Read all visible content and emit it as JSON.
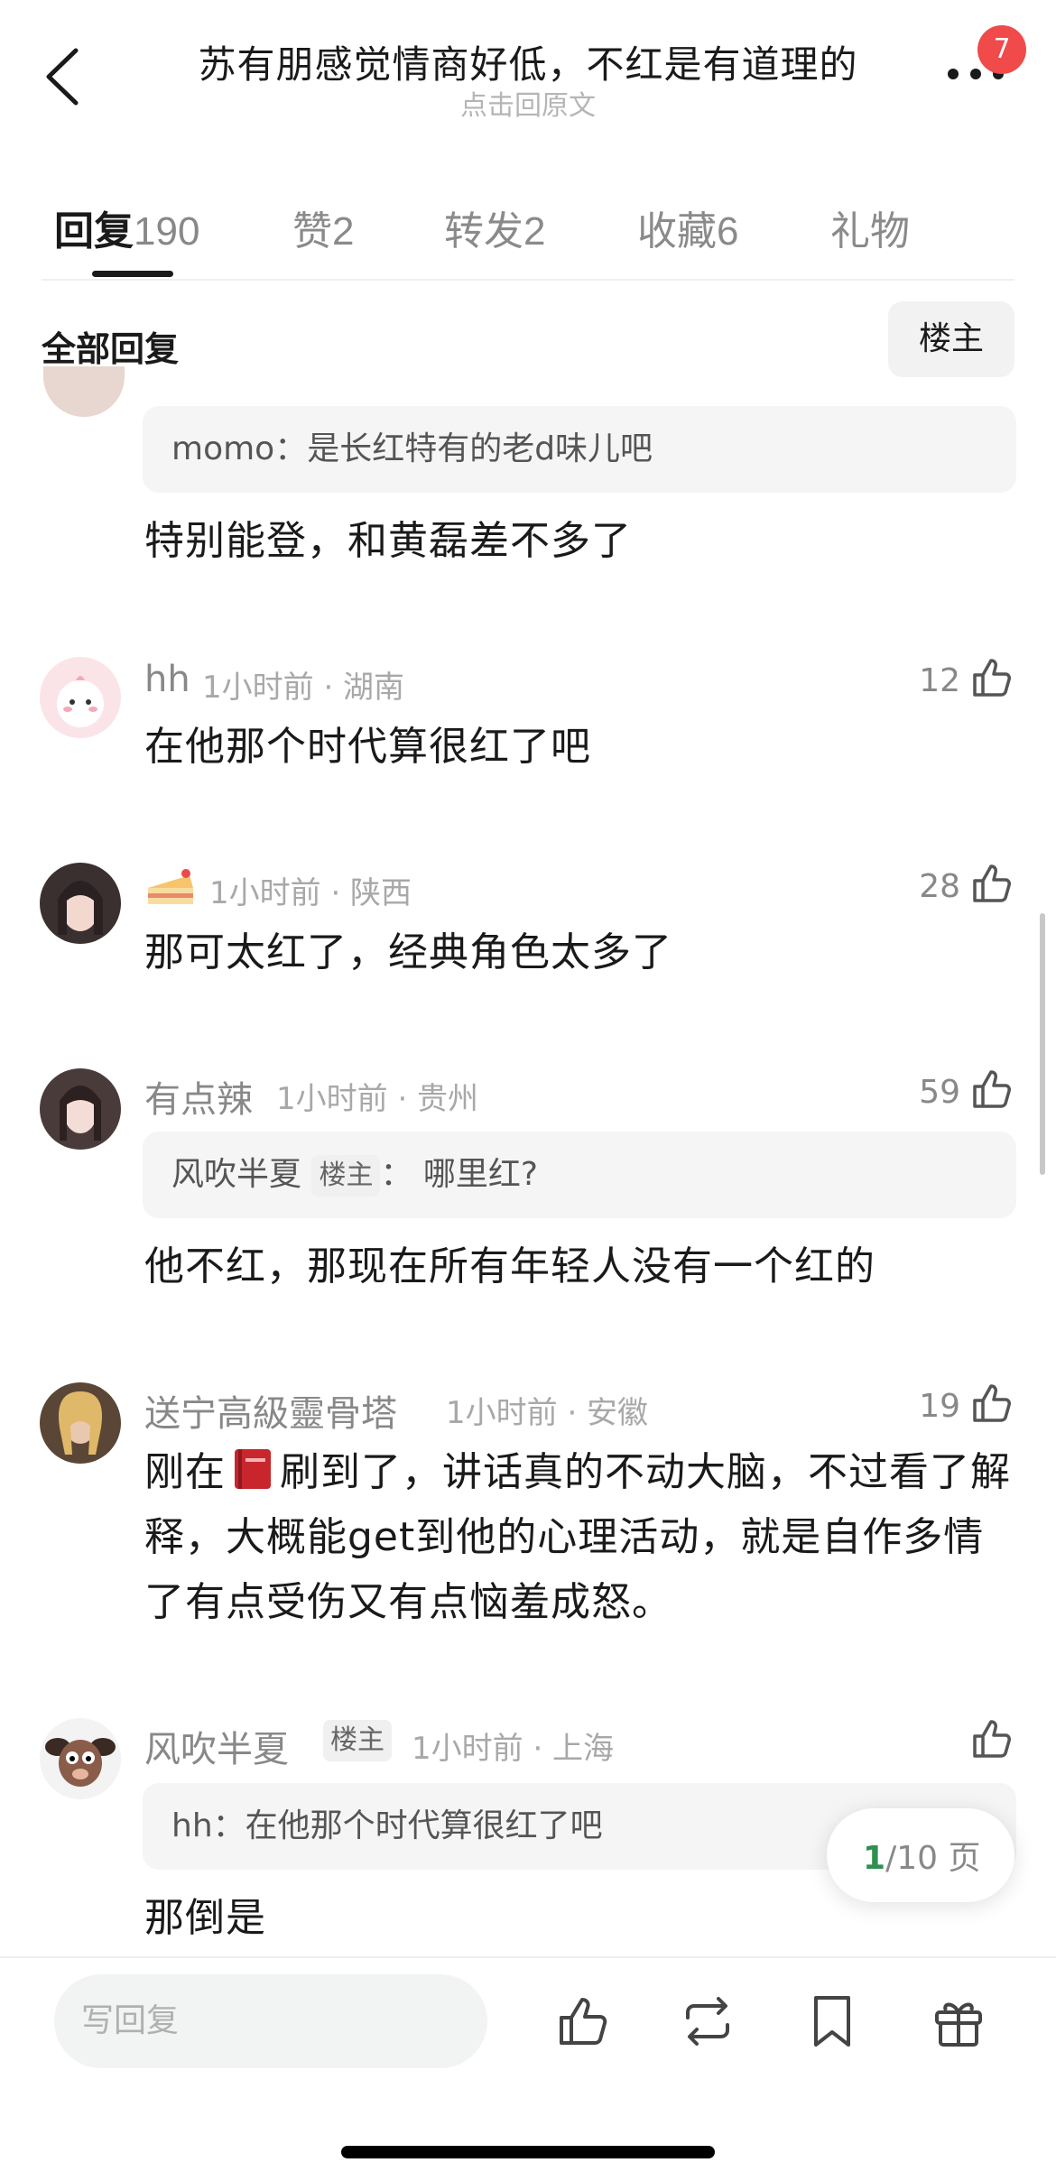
{
  "header": {
    "title": "苏有朋感觉情商好低，不红是有道理的",
    "subtitle": "点击回原文",
    "badge": "7"
  },
  "tabs": [
    {
      "label": "回复",
      "count": "190"
    },
    {
      "label": "赞",
      "count": "2"
    },
    {
      "label": "转发",
      "count": "2"
    },
    {
      "label": "收藏",
      "count": "6"
    },
    {
      "label": "礼物",
      "count": ""
    }
  ],
  "filter": {
    "title": "全部回复",
    "button": "楼主"
  },
  "comments": [
    {
      "quote": "momo：是长红特有的老d味儿吧",
      "text": "特别能登，和黄磊差不多了"
    },
    {
      "name": "hh",
      "meta": "1小时前 · 湖南",
      "likes": "12",
      "text": "在他那个时代算很红了吧"
    },
    {
      "name": "",
      "meta": "1小时前 · 陕西",
      "likes": "28",
      "text": "那可太红了，经典角色太多了"
    },
    {
      "name": "有点辣",
      "meta": "1小时前 · 贵州",
      "likes": "59",
      "quote_name": "风吹半夏",
      "quote_tag": "楼主",
      "quote_text": "： 哪里红?",
      "text": "他不红，那现在所有年轻人没有一个红的"
    },
    {
      "name": "送宁高級靈骨塔",
      "meta": "1小时前 · 安徽",
      "likes": "19",
      "text_a": "刚在",
      "text_b": "刷到了，讲话真的不动大脑，不过看了解释，大概能get到他的心理活动，就是自作多情了有点受伤又有点恼羞成怒。"
    },
    {
      "name": "风吹半夏",
      "tag": "楼主",
      "meta": "1小时前 · 上海",
      "likes": "",
      "quote": "hh：在他那个时代算很红了吧",
      "text": "那倒是"
    }
  ],
  "pager": {
    "current": "1",
    "total": "/10 页"
  },
  "bottom": {
    "placeholder": "写回复"
  },
  "colors": {
    "accent": "#2f8f4e",
    "badge": "#f04a4a"
  }
}
